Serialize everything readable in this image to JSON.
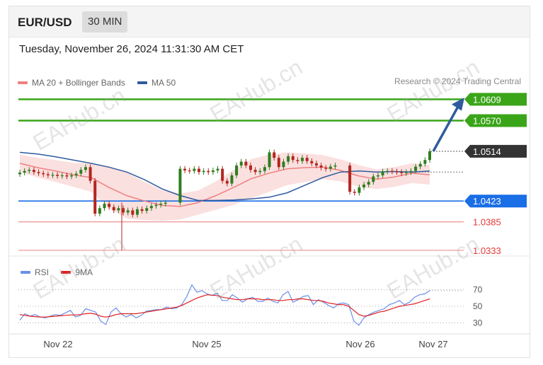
{
  "header": {
    "symbol": "EUR/USD",
    "timeframe": "30 MIN"
  },
  "datetime": "Tuesday, November 26, 2024 11:31:30 AM CET",
  "legend": [
    {
      "label": "MA 20 + Bollinger Bands",
      "color": "#f08080"
    },
    {
      "label": "MA 50",
      "color": "#2f5b9e"
    }
  ],
  "credit": "Research © 2024 Trading Central",
  "rsi_legend": [
    {
      "label": "RSI",
      "color": "#6b8ee8"
    },
    {
      "label": "9MA",
      "color": "#e02020"
    }
  ],
  "watermark": "EAHub.cn",
  "colors": {
    "resistance": "#3aa519",
    "support": "#1a6ee6",
    "support_minor": "#e03a3a",
    "current": "#333333",
    "candle_up": "#2e7d1f",
    "candle_down": "#b3261e",
    "bb_fill": "#fadada",
    "ma20": "#f08080",
    "ma50": "#2f5b9e",
    "arrow": "#2f5b9e"
  },
  "chart_data": [
    {
      "type": "candlestick",
      "title": "EUR/USD 30 MIN",
      "ylim": [
        1.0325,
        1.0625
      ],
      "x_ticks": [
        "Nov 22",
        "Nov 25",
        "Nov 26",
        "Nov 27"
      ],
      "levels": [
        {
          "value": 1.0609,
          "label": "1.0609",
          "kind": "resistance"
        },
        {
          "value": 1.057,
          "label": "1.0570",
          "kind": "resistance"
        },
        {
          "value": 1.0514,
          "label": "1.0514",
          "kind": "current"
        },
        {
          "value": 1.0423,
          "label": "1.0423",
          "kind": "support"
        },
        {
          "value": 1.0385,
          "label": "1.0385",
          "kind": "support_minor"
        },
        {
          "value": 1.0333,
          "label": "1.0333",
          "kind": "support_minor"
        }
      ],
      "close_path": [
        1.0475,
        1.0478,
        1.048,
        1.0476,
        1.0474,
        1.0472,
        1.047,
        1.0471,
        1.0469,
        1.047,
        1.0468,
        1.047,
        1.0473,
        1.048,
        1.0485,
        1.046,
        1.04,
        1.041,
        1.0418,
        1.0412,
        1.0406,
        1.041,
        1.0402,
        1.0406,
        1.0398,
        1.0408,
        1.0405,
        1.041,
        1.0414,
        1.0416,
        1.0418,
        1.042,
        1.0482,
        1.0479,
        1.0478,
        1.0482,
        1.0476,
        1.0478,
        1.0476,
        1.0479,
        1.0482,
        1.046,
        1.0455,
        1.047,
        1.0488,
        1.0495,
        1.0488,
        1.048,
        1.0476,
        1.0478,
        1.0485,
        1.0512,
        1.0502,
        1.0485,
        1.0495,
        1.0505,
        1.0498,
        1.0496,
        1.0502,
        1.0496,
        1.0492,
        1.0488,
        1.0484,
        1.0482,
        1.0486,
        1.0488,
        1.044,
        1.0438,
        1.0448,
        1.0453,
        1.0458,
        1.0468,
        1.047,
        1.0477,
        1.0478,
        1.0477,
        1.0476,
        1.0474,
        1.0476,
        1.0478,
        1.0486,
        1.0491,
        1.0498,
        1.0514
      ],
      "ma20_path": [
        1.0492,
        1.0484,
        1.0478,
        1.0471,
        1.0466,
        1.0448,
        1.0433,
        1.0423,
        1.0415,
        1.0413,
        1.042,
        1.0433,
        1.0448,
        1.0464,
        1.0474,
        1.0482,
        1.0484,
        1.0485,
        1.0479,
        1.0469,
        1.0463,
        1.0467,
        1.0474,
        1.0471
      ],
      "ma50_path": [
        1.0512,
        1.0509,
        1.0504,
        1.0498,
        1.0492,
        1.0485,
        1.0476,
        1.0462,
        1.0445,
        1.0433,
        1.0424,
        1.0424,
        1.0425,
        1.0427,
        1.043,
        1.0438,
        1.0452,
        1.0466,
        1.0476,
        1.0478,
        1.0476,
        1.0477,
        1.0476,
        1.0478
      ]
    },
    {
      "type": "line",
      "title": "RSI",
      "ylim": [
        20,
        80
      ],
      "y_ticks": [
        30,
        50,
        70
      ],
      "series": [
        {
          "name": "RSI",
          "values": [
            33,
            41,
            38,
            40,
            37,
            36,
            38,
            40,
            39,
            42,
            45,
            37,
            39,
            47,
            45,
            43,
            32,
            28,
            43,
            48,
            41,
            37,
            40,
            36,
            39,
            44,
            45,
            46,
            46,
            49,
            47,
            48,
            52,
            62,
            76,
            67,
            69,
            65,
            63,
            66,
            57,
            57,
            64,
            60,
            55,
            59,
            61,
            56,
            56,
            60,
            56,
            54,
            64,
            68,
            55,
            58,
            62,
            63,
            52,
            58,
            55,
            51,
            48,
            53,
            54,
            52,
            32,
            27,
            36,
            40,
            43,
            45,
            47,
            52,
            54,
            57,
            52,
            55,
            61,
            64,
            65,
            69
          ]
        },
        {
          "name": "9MA",
          "values": [
            40,
            39,
            38,
            37.5,
            37,
            37,
            37.5,
            38,
            38.5,
            39,
            39.5,
            39.5,
            40,
            41,
            41.5,
            40.5,
            38,
            37,
            38,
            40,
            41,
            41,
            41,
            41,
            42,
            43,
            44,
            45,
            46,
            47,
            48,
            49,
            51,
            54,
            57,
            60,
            62,
            64,
            63.5,
            63,
            61,
            60,
            59,
            58,
            58,
            59,
            59,
            59,
            58,
            58,
            58,
            57,
            57,
            58,
            58,
            59,
            59,
            58,
            57,
            57,
            56,
            54,
            53,
            52,
            52,
            50,
            45,
            40,
            38,
            39,
            41,
            43,
            44,
            46,
            48,
            50,
            51,
            52,
            53,
            55,
            57,
            59
          ]
        }
      ]
    }
  ]
}
